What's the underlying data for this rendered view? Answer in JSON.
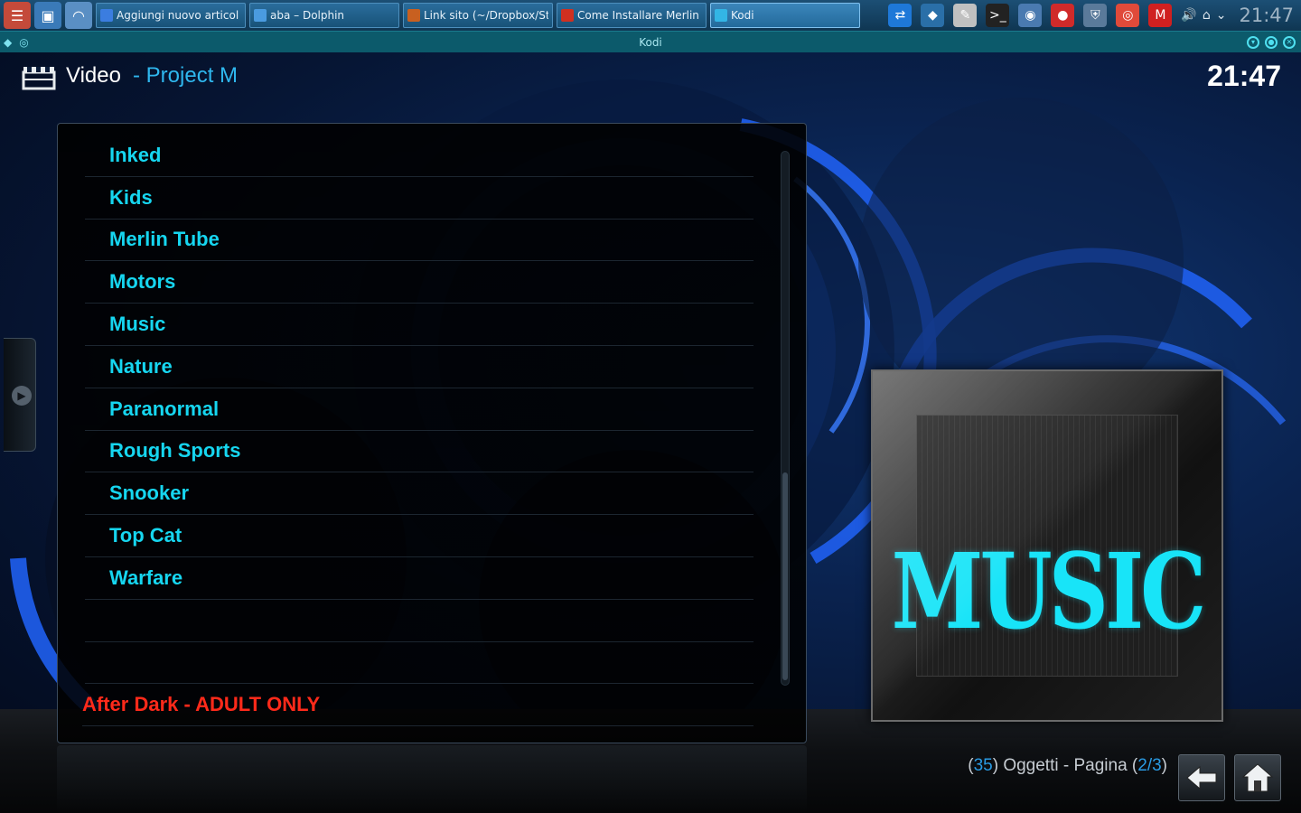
{
  "taskbar": {
    "launchers": [
      {
        "icon": "app-menu-icon",
        "color": "#c44a3a"
      },
      {
        "icon": "desktop-icon",
        "color": "#3a7ab8"
      },
      {
        "icon": "dolphin-launcher-icon",
        "color": "#5a8fc4"
      }
    ],
    "tasks": [
      {
        "label": "Aggiungi nuovo articol",
        "icon": "chrome-icon",
        "color": "#3b7de0",
        "active": false
      },
      {
        "label": "aba – Dolphin",
        "icon": "folder-icon",
        "color": "#4a9be0",
        "active": false
      },
      {
        "label": "Link sito (~/Dropbox/St",
        "icon": "editor-icon",
        "color": "#c86020",
        "active": false
      },
      {
        "label": "Come Installare Merlin",
        "icon": "browser-icon",
        "color": "#d03020",
        "active": false
      },
      {
        "label": "Kodi",
        "icon": "kodi-icon",
        "color": "#33b5e5",
        "active": true
      }
    ],
    "tray": [
      {
        "icon": "teamviewer-icon",
        "color": "#1e78d8"
      },
      {
        "icon": "kodi-tray-icon",
        "color": "#2a6fa8"
      },
      {
        "icon": "notes-icon",
        "color": "#c0c0c0"
      },
      {
        "icon": "terminal-icon",
        "color": "#222222"
      },
      {
        "icon": "screenshot-icon",
        "color": "#4a7ab0"
      },
      {
        "icon": "recorder-icon",
        "color": "#d02a2a"
      },
      {
        "icon": "shield-icon",
        "color": "#5a7a9a"
      },
      {
        "icon": "fingerprint-icon",
        "color": "#e04a3a"
      },
      {
        "icon": "mail-icon",
        "color": "#d02020"
      },
      {
        "icon": "volume-icon",
        "color": "#dfe8ef"
      },
      {
        "icon": "network-icon",
        "color": "#dfe8ef"
      },
      {
        "icon": "expand-tray-icon",
        "color": "#dfe8ef"
      }
    ],
    "clock": "21:47"
  },
  "window": {
    "title": "Kodi"
  },
  "kodi": {
    "section": "Video",
    "subsection": "- Project M",
    "clock": "21:47",
    "items": [
      "Inked",
      "Kids",
      "Merlin Tube",
      "Motors",
      "Music",
      "Nature",
      "Paranormal",
      "Rough Sports",
      "Snooker",
      "Top Cat",
      "Warfare",
      "",
      "",
      "After Dark - ADULT ONLY"
    ],
    "thumbnail_text": "MUSIC",
    "footer": {
      "count_open": "(",
      "count": "35",
      "count_close": ")",
      "objects_label": " Oggetti - Pagina ",
      "page_open": "(",
      "page": "2/3",
      "page_close": ")"
    },
    "colors": {
      "item": "#16d6f0",
      "adult_item": "#ff2a1a",
      "accent": "#2fb7ee"
    }
  }
}
